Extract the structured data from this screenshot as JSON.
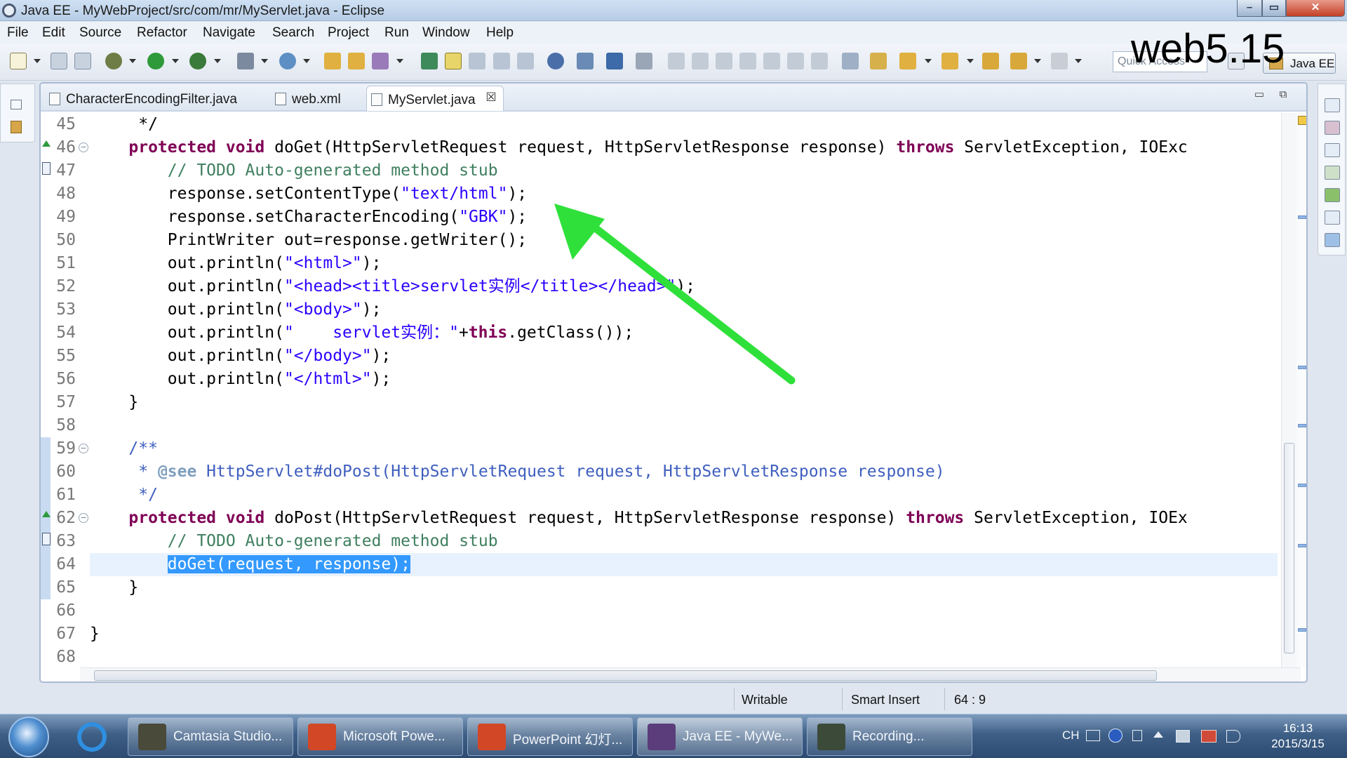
{
  "window": {
    "title": "Java EE - MyWebProject/src/com/mr/MyServlet.java - Eclipse"
  },
  "menu": [
    "File",
    "Edit",
    "Source",
    "Refactor",
    "Navigate",
    "Search",
    "Project",
    "Run",
    "Window",
    "Help"
  ],
  "toolbar": {
    "quick_access_placeholder": "Quick Access",
    "perspective": "Java EE",
    "overlay_text": "web5.15"
  },
  "tabs": [
    {
      "label": "CharacterEncodingFilter.java",
      "active": false
    },
    {
      "label": "web.xml",
      "active": false
    },
    {
      "label": "MyServlet.java",
      "active": true
    }
  ],
  "tab_close": "☒",
  "code": {
    "current_line": 64,
    "lines": [
      {
        "n": "45",
        "marker": "",
        "fold": "",
        "html": "     */"
      },
      {
        "n": "46",
        "marker": "override",
        "fold": "⊖",
        "html": "    <span class=\"kw\">protected void</span> doGet(HttpServletRequest request, HttpServletResponse response) <span class=\"kw\">throws</span> ServletException, IOExc"
      },
      {
        "n": "47",
        "marker": "todo",
        "fold": "",
        "html": "        <span class=\"com\">// TODO Auto-generated method stub</span>"
      },
      {
        "n": "48",
        "marker": "",
        "fold": "",
        "html": "        response.setContentType(<span class=\"str\">\"text/html\"</span>);"
      },
      {
        "n": "49",
        "marker": "",
        "fold": "",
        "html": "        response.setCharacterEncoding(<span class=\"str\">\"GBK\"</span>);"
      },
      {
        "n": "50",
        "marker": "",
        "fold": "",
        "html": "        PrintWriter out=response.getWriter();"
      },
      {
        "n": "51",
        "marker": "",
        "fold": "",
        "html": "        out.println(<span class=\"str\">\"&lt;html&gt;\"</span>);"
      },
      {
        "n": "52",
        "marker": "",
        "fold": "",
        "html": "        out.println(<span class=\"str\">\"&lt;head&gt;&lt;title&gt;servlet实例&lt;/title&gt;&lt;/head&gt;\"</span>);"
      },
      {
        "n": "53",
        "marker": "",
        "fold": "",
        "html": "        out.println(<span class=\"str\">\"&lt;body&gt;\"</span>);"
      },
      {
        "n": "54",
        "marker": "",
        "fold": "",
        "html": "        out.println(<span class=\"str\">\"    servlet实例：\"</span>+<span class=\"kw\">this</span>.getClass());"
      },
      {
        "n": "55",
        "marker": "",
        "fold": "",
        "html": "        out.println(<span class=\"str\">\"&lt;/body&gt;\"</span>);"
      },
      {
        "n": "56",
        "marker": "",
        "fold": "",
        "html": "        out.println(<span class=\"str\">\"&lt;/html&gt;\"</span>);"
      },
      {
        "n": "57",
        "marker": "",
        "fold": "",
        "html": "    }"
      },
      {
        "n": "58",
        "marker": "",
        "fold": "",
        "html": ""
      },
      {
        "n": "59",
        "marker": "",
        "fold": "⊖",
        "html": "    <span class=\"doc\">/**</span>"
      },
      {
        "n": "60",
        "marker": "",
        "fold": "",
        "html": "<span class=\"doc\">     * <span class=\"ann\">@see</span> HttpServlet#doPost(HttpServletRequest request, HttpServletResponse response)</span>"
      },
      {
        "n": "61",
        "marker": "",
        "fold": "",
        "html": "<span class=\"doc\">     */</span>"
      },
      {
        "n": "62",
        "marker": "override",
        "fold": "⊖",
        "html": "    <span class=\"kw\">protected void</span> doPost(HttpServletRequest request, HttpServletResponse response) <span class=\"kw\">throws</span> ServletException, IOEx"
      },
      {
        "n": "63",
        "marker": "todo",
        "fold": "",
        "html": "        <span class=\"com\">// TODO Auto-generated method stub</span>"
      },
      {
        "n": "64",
        "marker": "",
        "fold": "",
        "html": "        <span class=\"sel\">doGet(request, response);</span>"
      },
      {
        "n": "65",
        "marker": "",
        "fold": "",
        "html": "    }"
      },
      {
        "n": "66",
        "marker": "",
        "fold": "",
        "html": ""
      },
      {
        "n": "67",
        "marker": "",
        "fold": "",
        "html": "}"
      },
      {
        "n": "68",
        "marker": "",
        "fold": "",
        "html": ""
      }
    ]
  },
  "status": {
    "writable": "Writable",
    "insert_mode": "Smart Insert",
    "position": "64 : 9"
  },
  "taskbar": {
    "items": [
      {
        "label": "Camtasia Studio...",
        "active": false,
        "color": "#4a4a3a"
      },
      {
        "label": "Microsoft Powe...",
        "active": false,
        "color": "#d24726"
      },
      {
        "label": "PowerPoint 幻灯...",
        "active": false,
        "color": "#d24726"
      },
      {
        "label": "Java EE - MyWe...",
        "active": true,
        "color": "#5a3d7a"
      },
      {
        "label": "Recording...",
        "active": false,
        "color": "#3c4a3a"
      }
    ],
    "lang": "CH",
    "time": "16:13",
    "date": "2015/3/15"
  },
  "colors": {
    "keyword": "#7f0055",
    "string": "#2a00ff",
    "comment": "#3f7f5f",
    "javadoc": "#3f5fbf",
    "selection": "#3399ff",
    "arrow": "#2fe03a"
  }
}
